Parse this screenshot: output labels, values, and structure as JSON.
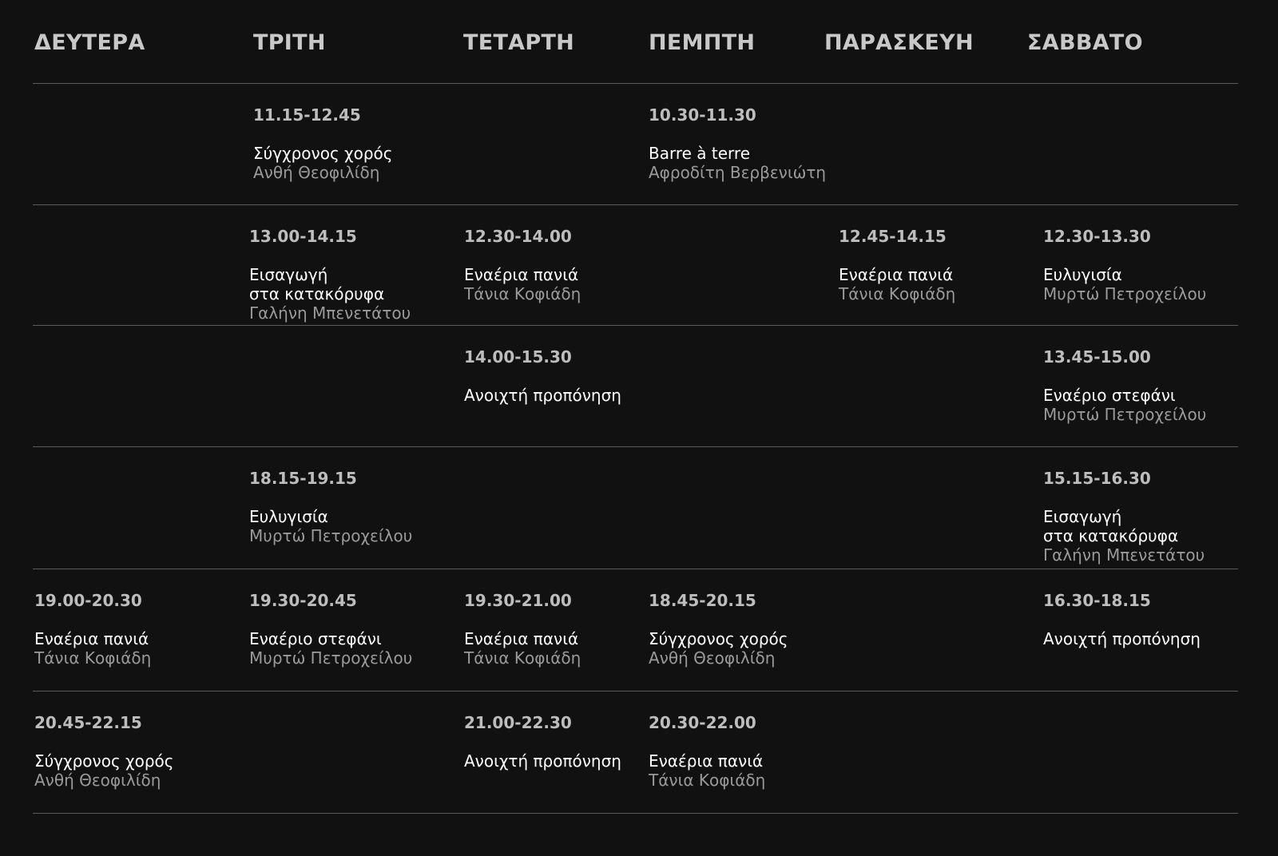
{
  "days": [
    "ΔΕΥΤΕΡΑ",
    "ΤΡΙΤΗ",
    "ΤΕΤΑΡΤΗ",
    "ΠΕΜΠΤΗ",
    "ΠΑΡΑΣΚΕΥΗ",
    "ΣΑΒΒΑΤΟ"
  ],
  "rows": [
    [
      null,
      {
        "time": "11.15-12.45",
        "title": [
          "Σύγχρονος χορός"
        ],
        "instructor": "Ανθή Θεοφιλίδη"
      },
      null,
      {
        "time": "10.30-11.30",
        "title": [
          "Barre à terre"
        ],
        "instructor": "Αφροδίτη Βερβενιώτη"
      },
      null,
      null
    ],
    [
      null,
      {
        "time": "13.00-14.15",
        "title": [
          "Εισαγωγή",
          "στα κατακόρυφα"
        ],
        "instructor": "Γαλήνη Μπενετάτου"
      },
      {
        "time": "12.30-14.00",
        "title": [
          "Εναέρια πανιά"
        ],
        "instructor": "Τάνια Κοφιάδη"
      },
      null,
      {
        "time": "12.45-14.15",
        "title": [
          "Εναέρια πανιά"
        ],
        "instructor": "Τάνια Κοφιάδη"
      },
      {
        "time": "12.30-13.30",
        "title": [
          "Ευλυγισία"
        ],
        "instructor": "Μυρτώ Πετροχείλου"
      }
    ],
    [
      null,
      null,
      {
        "time": "14.00-15.30",
        "title": [
          "Ανοιχτή προπόνηση"
        ],
        "instructor": ""
      },
      null,
      null,
      {
        "time": "13.45-15.00",
        "title": [
          "Εναέριο στεφάνι"
        ],
        "instructor": "Μυρτώ Πετροχείλου"
      }
    ],
    [
      null,
      {
        "time": "18.15-19.15",
        "title": [
          "Ευλυγισία"
        ],
        "instructor": "Μυρτώ Πετροχείλου"
      },
      null,
      null,
      null,
      {
        "time": "15.15-16.30",
        "title": [
          "Εισαγωγή",
          "στα κατακόρυφα"
        ],
        "instructor": "Γαλήνη Μπενετάτου"
      }
    ],
    [
      {
        "time": "19.00-20.30",
        "title": [
          "Εναέρια πανιά"
        ],
        "instructor": "Τάνια Κοφιάδη"
      },
      {
        "time": "19.30-20.45",
        "title": [
          "Εναέριο στεφάνι"
        ],
        "instructor": "Μυρτώ Πετροχείλου"
      },
      {
        "time": "19.30-21.00",
        "title": [
          "Εναέρια πανιά"
        ],
        "instructor": "Τάνια Κοφιάδη"
      },
      {
        "time": "18.45-20.15",
        "title": [
          "Σύγχρονος χορός"
        ],
        "instructor": "Ανθή Θεοφιλίδη"
      },
      null,
      {
        "time": "16.30-18.15",
        "title": [
          "Ανοιχτή προπόνηση"
        ],
        "instructor": ""
      }
    ],
    [
      {
        "time": "20.45-22.15",
        "title": [
          "Σύγχρονος χορός"
        ],
        "instructor": "Ανθή Θεοφιλίδη"
      },
      null,
      {
        "time": "21.00-22.30",
        "title": [
          "Ανοιχτή προπόνηση"
        ],
        "instructor": ""
      },
      {
        "time": "20.30-22.00",
        "title": [
          "Εναέρια πανιά"
        ],
        "instructor": "Τάνια Κοφιάδη"
      },
      null,
      null
    ]
  ]
}
